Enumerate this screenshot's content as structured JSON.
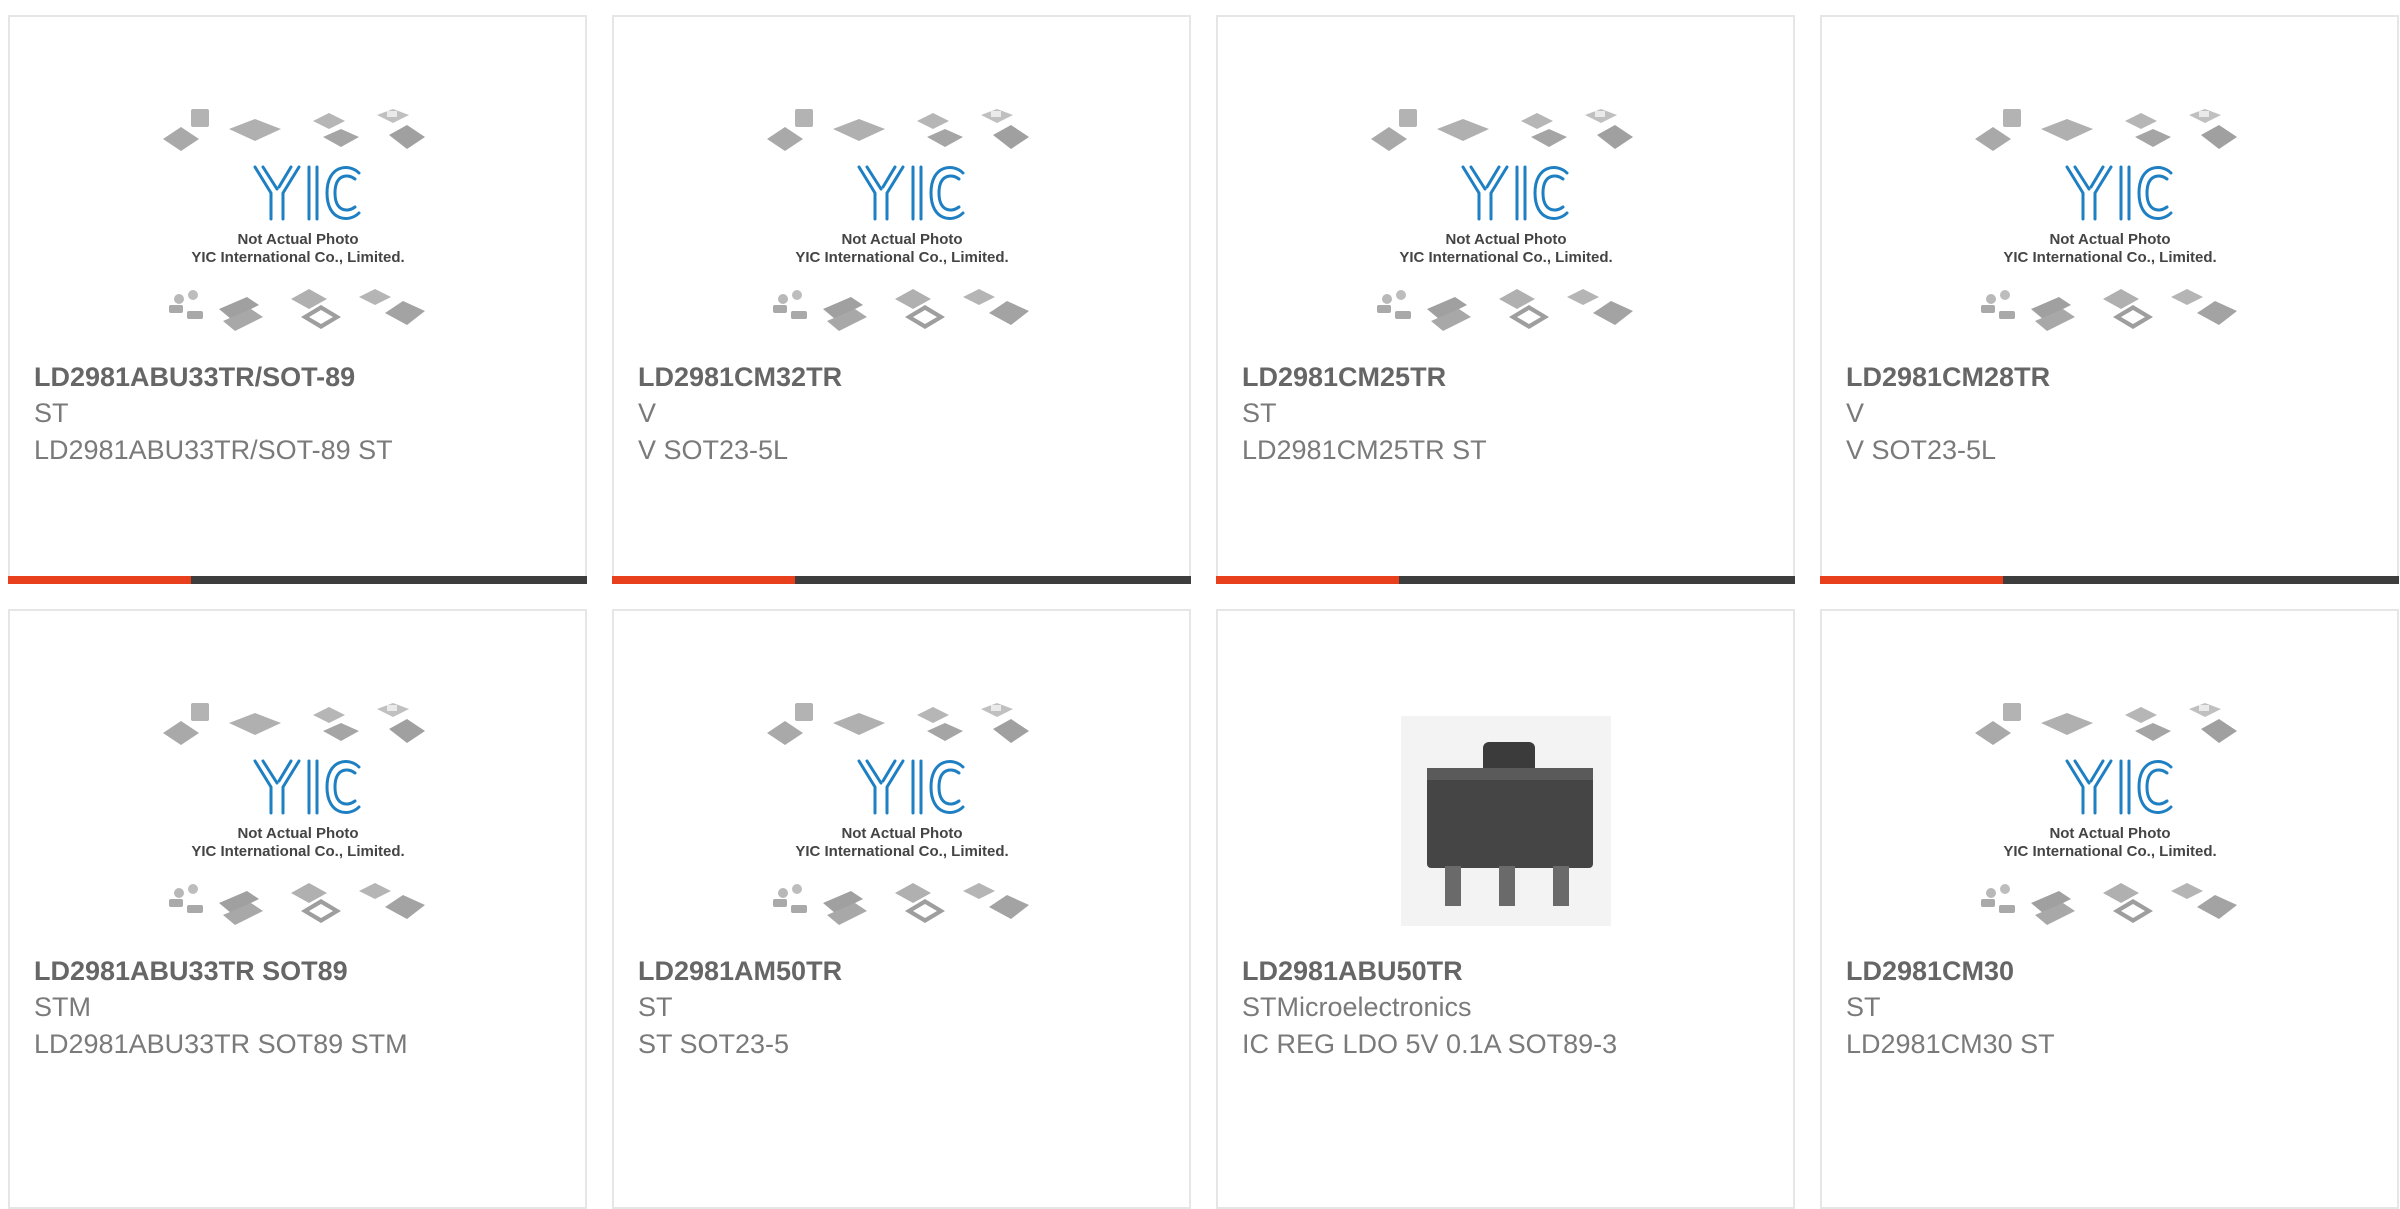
{
  "placeholder": {
    "line1": "Not Actual Photo",
    "line2": "YIC International Co., Limited."
  },
  "colors": {
    "accent": "#e8401c",
    "bar": "#3d3d3d",
    "logo": "#1e7fc2"
  },
  "products": [
    {
      "name": "LD2981ABU33TR/SOT-89",
      "manufacturer": "ST",
      "description": "LD2981ABU33TR/SOT-89 ST",
      "image": "placeholder-logo"
    },
    {
      "name": "LD2981CM32TR",
      "manufacturer": "V",
      "description": "V SOT23-5L",
      "image": "placeholder-logo"
    },
    {
      "name": "LD2981CM25TR",
      "manufacturer": "ST",
      "description": "LD2981CM25TR ST",
      "image": "placeholder-logo"
    },
    {
      "name": "LD2981CM28TR",
      "manufacturer": "V",
      "description": "V SOT23-5L",
      "image": "placeholder-logo"
    },
    {
      "name": "LD2981ABU33TR SOT89",
      "manufacturer": "STM",
      "description": "LD2981ABU33TR SOT89 STM",
      "image": "placeholder-logo"
    },
    {
      "name": "LD2981AM50TR",
      "manufacturer": "ST",
      "description": "ST SOT23-5",
      "image": "placeholder-logo"
    },
    {
      "name": "LD2981ABU50TR",
      "manufacturer": "STMicroelectronics",
      "description": "IC REG LDO 5V 0.1A SOT89-3",
      "image": "sot89-chip-photo"
    },
    {
      "name": "LD2981CM30",
      "manufacturer": "ST",
      "description": "LD2981CM30 ST",
      "image": "placeholder-logo"
    }
  ]
}
